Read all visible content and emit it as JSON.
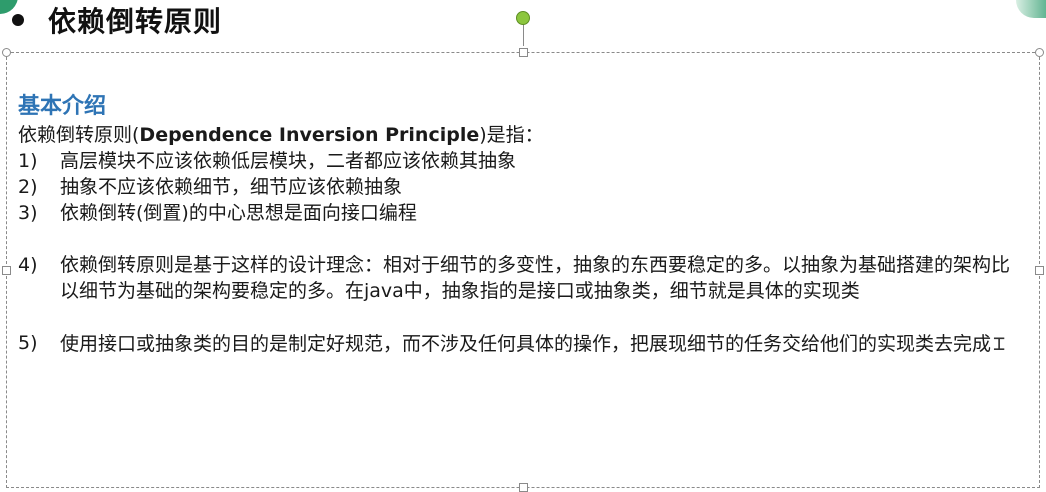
{
  "slide": {
    "heading": "依赖倒转原则",
    "section_title": "基本介绍",
    "intro": {
      "prefix": "依赖倒转原则(",
      "term": "Dependence Inversion Principle",
      "suffix": ")是指："
    },
    "items": [
      {
        "num": "1)",
        "text": "高层模块不应该依赖低层模块，二者都应该依赖其抽象"
      },
      {
        "num": "2)",
        "text": "抽象不应该依赖细节，细节应该依赖抽象"
      },
      {
        "num": "3)",
        "text": "依赖倒转(倒置)的中心思想是面向接口编程"
      },
      {
        "num": "4)",
        "text": "依赖倒转原则是基于这样的设计理念：相对于细节的多变性，抽象的东西要稳定的多。以抽象为基础搭建的架构比以细节为基础的架构要稳定的多。在java中，抽象指的是接口或抽象类，细节就是具体的实现类"
      },
      {
        "num": "5)",
        "text": "使用接口或抽象类的目的是制定好规范，而不涉及任何具体的操作，把展现细节的任务交给他们的实现类去完成"
      }
    ]
  },
  "colors": {
    "section_title": "#2e74b5",
    "rotate_handle": "#8cc63e",
    "accent": "#2e9c6c"
  },
  "icons": {
    "bullet": "bullet-dot-icon",
    "rotate": "rotate-handle-icon",
    "cursor": "text-cursor-icon"
  }
}
